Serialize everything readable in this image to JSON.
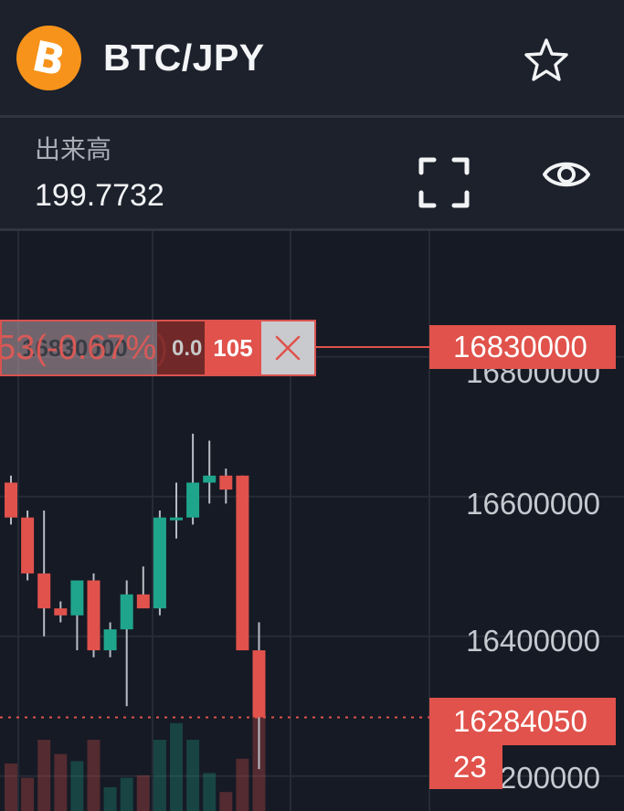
{
  "header": {
    "coin_icon": "bitcoin-icon",
    "coin_symbol": "B",
    "pair": "BTC/JPY",
    "favorite_icon": "star-outline-icon"
  },
  "info": {
    "volume_label": "出来高",
    "volume_value": "199.7732",
    "fullscreen_icon": "fullscreen-icon",
    "visibility_icon": "eye-icon"
  },
  "chart": {
    "y_ticks": [
      "16800000",
      "16600000",
      "16400000",
      "16200000"
    ],
    "order_line": {
      "pct_text": "53(-0.67%)",
      "price_text": "16830000",
      "qty_small": "0.0",
      "qty": "105",
      "close_icon": "close-icon",
      "price_tag": "16830000"
    },
    "last_price_tag": "16284050",
    "countdown_tag": "23"
  },
  "colors": {
    "background": "#161a25",
    "panel": "#1c212c",
    "up": "#1fa58c",
    "down": "#e0524b",
    "coin": "#f7931a"
  },
  "chart_data": {
    "type": "candlestick",
    "ylim": [
      16150000,
      16980000
    ],
    "candles": [
      {
        "o": 16620000,
        "h": 16630000,
        "l": 16560000,
        "c": 16570000
      },
      {
        "o": 16570000,
        "h": 16580000,
        "l": 16480000,
        "c": 16490000
      },
      {
        "o": 16490000,
        "h": 16580000,
        "l": 16400000,
        "c": 16440000
      },
      {
        "o": 16440000,
        "h": 16450000,
        "l": 16420000,
        "c": 16430000
      },
      {
        "o": 16430000,
        "h": 16470000,
        "l": 16380000,
        "c": 16480000
      },
      {
        "o": 16480000,
        "h": 16490000,
        "l": 16370000,
        "c": 16380000
      },
      {
        "o": 16380000,
        "h": 16420000,
        "l": 16370000,
        "c": 16410000
      },
      {
        "o": 16410000,
        "h": 16480000,
        "l": 16300000,
        "c": 16460000
      },
      {
        "o": 16460000,
        "h": 16500000,
        "l": 16450000,
        "c": 16440000
      },
      {
        "o": 16440000,
        "h": 16580000,
        "l": 16430000,
        "c": 16570000
      },
      {
        "o": 16570000,
        "h": 16620000,
        "l": 16540000,
        "c": 16570000
      },
      {
        "o": 16570000,
        "h": 16690000,
        "l": 16560000,
        "c": 16620000
      },
      {
        "o": 16620000,
        "h": 16680000,
        "l": 16590000,
        "c": 16630000
      },
      {
        "o": 16630000,
        "h": 16640000,
        "l": 16590000,
        "c": 16610000
      },
      {
        "o": 16630000,
        "h": 16630000,
        "l": 16380000,
        "c": 16380000
      },
      {
        "o": 16380000,
        "h": 16420000,
        "l": 16210000,
        "c": 16284050
      }
    ],
    "volume_max": 100,
    "volumes": [
      20,
      14,
      30,
      24,
      21,
      30,
      10,
      14,
      15,
      30,
      37,
      30,
      16,
      8,
      22,
      46
    ]
  }
}
